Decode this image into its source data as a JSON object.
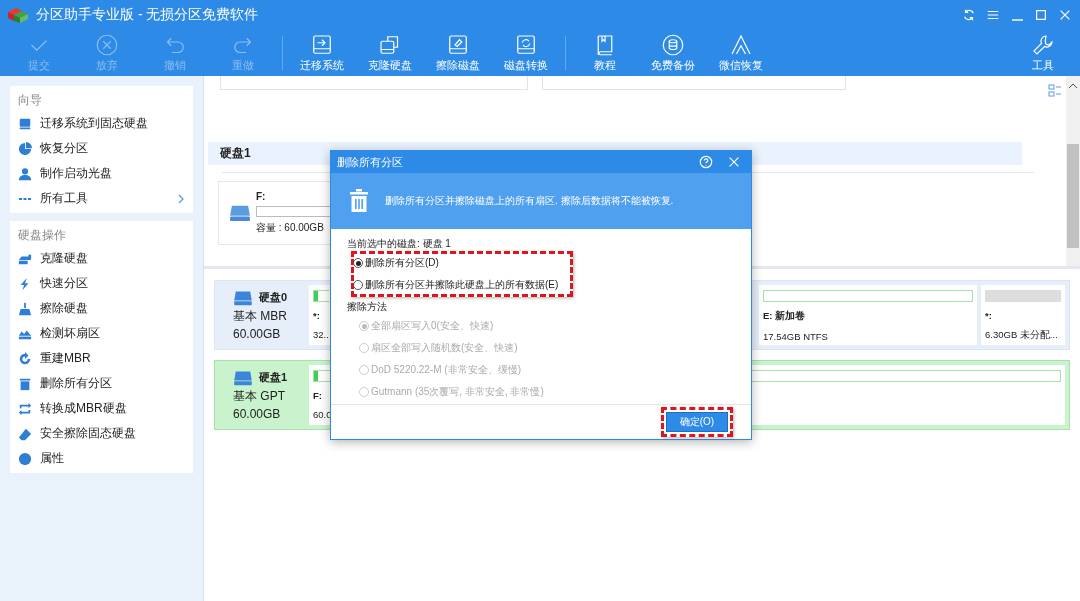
{
  "window": {
    "title": "分区助手专业版 - 无损分区免费软件"
  },
  "toolbar": {
    "groups": [
      [
        {
          "label": "提交",
          "disabled": true
        },
        {
          "label": "放弃",
          "disabled": true
        },
        {
          "label": "撤销",
          "disabled": true
        },
        {
          "label": "重做",
          "disabled": true
        }
      ],
      [
        {
          "label": "迁移系统",
          "disabled": false
        },
        {
          "label": "克隆硬盘",
          "disabled": false
        },
        {
          "label": "擦除磁盘",
          "disabled": false
        },
        {
          "label": "磁盘转换",
          "disabled": false
        }
      ],
      [
        {
          "label": "教程",
          "disabled": false
        },
        {
          "label": "免费备份",
          "disabled": false
        },
        {
          "label": "微信恢复",
          "disabled": false
        }
      ]
    ],
    "tools": {
      "label": "工具"
    }
  },
  "sidebar": {
    "sections": [
      {
        "heading": "向导",
        "items": [
          {
            "label": "迁移系统到固态硬盘",
            "expandable": false
          },
          {
            "label": "恢复分区",
            "expandable": false
          },
          {
            "label": "制作启动光盘",
            "expandable": false
          },
          {
            "label": "所有工具",
            "expandable": true
          }
        ]
      },
      {
        "heading": "硬盘操作",
        "items": [
          {
            "label": "克隆硬盘",
            "expandable": false
          },
          {
            "label": "快速分区",
            "expandable": false
          },
          {
            "label": "擦除硬盘",
            "expandable": false
          },
          {
            "label": "检测坏扇区",
            "expandable": false
          },
          {
            "label": "重建MBR",
            "expandable": false
          },
          {
            "label": "删除所有分区",
            "expandable": false
          },
          {
            "label": "转换成MBR硬盘",
            "expandable": false
          },
          {
            "label": "安全擦除固态硬盘",
            "expandable": false
          },
          {
            "label": "属性",
            "expandable": false
          }
        ]
      }
    ]
  },
  "disk_detail": {
    "title": "硬盘1",
    "partitions": [
      {
        "name": "F:",
        "capacity": "容量 : 60.00GB"
      }
    ]
  },
  "disks": [
    {
      "name": "硬盘0",
      "type": "基本 MBR",
      "size": "60.00GB",
      "selected": false,
      "partitions": [
        {
          "kind": "narrow",
          "name": "*:",
          "info": "32..",
          "level": 0.25
        },
        {
          "kind": "normal",
          "name": "E: 新加卷",
          "info": "17.54GB NTFS"
        },
        {
          "kind": "unallocated",
          "name": "*:",
          "info": "6.30GB 未分配..."
        }
      ]
    },
    {
      "name": "硬盘1",
      "type": "基本 GPT",
      "size": "60.00GB",
      "selected": true,
      "partitions": [
        {
          "kind": "wide",
          "name": "F:",
          "info": "60.0",
          "level": 0.005
        }
      ]
    }
  ],
  "dialog": {
    "title": "删除所有分区",
    "banner": "删除所有分区并擦除磁盘上的所有扇区. 擦除后数据将不能被恢复.",
    "current_disk": "当前选中的磁盘: 硬盘 1",
    "options": [
      {
        "label": "删除所有分区(D)",
        "selected": true
      },
      {
        "label": "删除所有分区并擦除此硬盘上的所有数据(E)",
        "selected": false
      }
    ],
    "method_heading": "擦除方法",
    "methods": [
      {
        "label": "全部扇区写入0(安全、快速)",
        "selected": true,
        "disabled": true
      },
      {
        "label": "扇区全部写入随机数(安全、快速)",
        "selected": false,
        "disabled": true
      },
      {
        "label": "DoD 5220.22-M (非常安全、缓慢)",
        "selected": false,
        "disabled": true
      },
      {
        "label": "Gutmann (35次覆写, 非常安全, 非常慢)",
        "selected": false,
        "disabled": true
      }
    ],
    "ok": "确定(O)"
  }
}
